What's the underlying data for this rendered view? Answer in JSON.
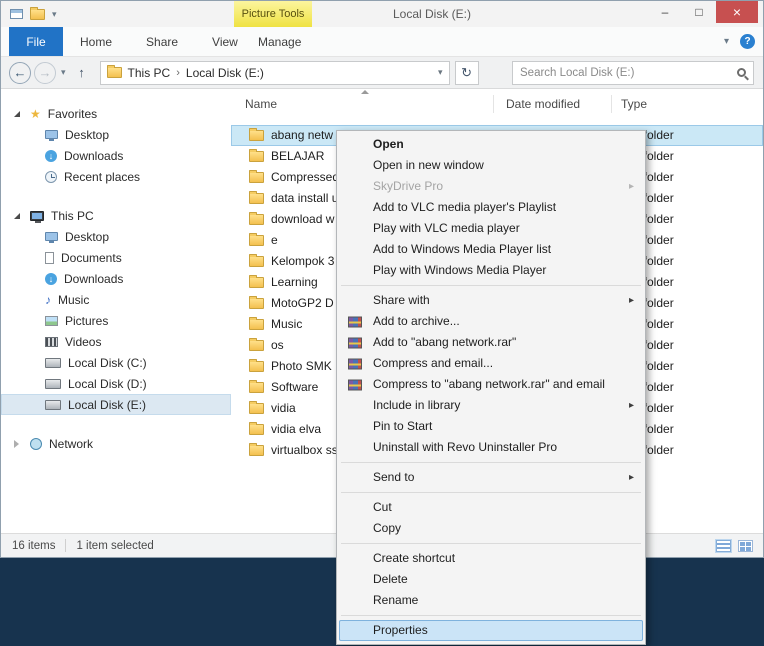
{
  "titlebar": {
    "contextual_label": "Picture Tools",
    "title": "Local Disk (E:)"
  },
  "ribbon": {
    "file_tab": "File",
    "tabs": [
      "Home",
      "Share",
      "View"
    ],
    "manage_tab": "Manage"
  },
  "address": {
    "crumbs": [
      "This PC",
      "Local Disk (E:)"
    ],
    "search_placeholder": "Search Local Disk (E:)"
  },
  "sidebar": {
    "selected": "Local Disk (E:)",
    "sections": [
      {
        "label": "Favorites",
        "icon": "star-icon",
        "expanded": true,
        "items": [
          {
            "label": "Desktop",
            "icon": "monitor-icon"
          },
          {
            "label": "Downloads",
            "icon": "download-icon"
          },
          {
            "label": "Recent places",
            "icon": "clock-icon"
          }
        ]
      },
      {
        "label": "This PC",
        "icon": "computer-icon",
        "expanded": true,
        "items": [
          {
            "label": "Desktop",
            "icon": "monitor-icon"
          },
          {
            "label": "Documents",
            "icon": "document-icon"
          },
          {
            "label": "Downloads",
            "icon": "download-icon"
          },
          {
            "label": "Music",
            "icon": "music-icon"
          },
          {
            "label": "Pictures",
            "icon": "picture-icon"
          },
          {
            "label": "Videos",
            "icon": "video-icon"
          },
          {
            "label": "Local Disk (C:)",
            "icon": "drive-icon"
          },
          {
            "label": "Local Disk (D:)",
            "icon": "drive-icon"
          },
          {
            "label": "Local Disk (E:)",
            "icon": "drive-icon"
          }
        ]
      },
      {
        "label": "Network",
        "icon": "network-icon",
        "expanded": false,
        "items": []
      }
    ]
  },
  "filelist": {
    "columns": [
      "Name",
      "Date modified",
      "Type"
    ],
    "rows": [
      {
        "name": "abang netw",
        "type": "File folder",
        "selected": true
      },
      {
        "name": "BELAJAR",
        "type": "File folder"
      },
      {
        "name": "Compressed",
        "type": "File folder"
      },
      {
        "name": "data install u",
        "type": "File folder"
      },
      {
        "name": "download w",
        "type": "File folder"
      },
      {
        "name": "e",
        "type": "File folder"
      },
      {
        "name": "Kelompok 3",
        "type": "File folder"
      },
      {
        "name": "Learning",
        "type": "File folder"
      },
      {
        "name": "MotoGP2 D",
        "type": "File folder"
      },
      {
        "name": "Music",
        "type": "File folder"
      },
      {
        "name": "os",
        "type": "File folder"
      },
      {
        "name": "Photo SMK",
        "type": "File folder"
      },
      {
        "name": "Software",
        "type": "File folder"
      },
      {
        "name": "vidia",
        "type": "File folder"
      },
      {
        "name": "vidia elva",
        "type": "File folder"
      },
      {
        "name": "virtualbox ss",
        "type": "File folder"
      }
    ]
  },
  "context_menu": {
    "items": [
      {
        "label": "Open",
        "bold": true
      },
      {
        "label": "Open in new window"
      },
      {
        "label": "SkyDrive Pro",
        "disabled": true,
        "submenu": true
      },
      {
        "label": "Add to VLC media player's Playlist"
      },
      {
        "label": "Play with VLC media player"
      },
      {
        "label": "Add to Windows Media Player list"
      },
      {
        "label": "Play with Windows Media Player"
      },
      {
        "separator": true
      },
      {
        "label": "Share with",
        "submenu": true
      },
      {
        "label": "Add to archive...",
        "icon": "winrar-icon"
      },
      {
        "label": "Add to \"abang network.rar\"",
        "icon": "winrar-icon"
      },
      {
        "label": "Compress and email...",
        "icon": "winrar-icon"
      },
      {
        "label": "Compress to \"abang network.rar\" and email",
        "icon": "winrar-icon"
      },
      {
        "label": "Include in library",
        "submenu": true
      },
      {
        "label": "Pin to Start"
      },
      {
        "label": "Uninstall with Revo Uninstaller Pro"
      },
      {
        "separator": true
      },
      {
        "label": "Send to",
        "submenu": true
      },
      {
        "separator": true
      },
      {
        "label": "Cut"
      },
      {
        "label": "Copy"
      },
      {
        "separator": true
      },
      {
        "label": "Create shortcut"
      },
      {
        "label": "Delete"
      },
      {
        "label": "Rename"
      },
      {
        "separator": true
      },
      {
        "label": "Properties",
        "highlighted": true
      }
    ]
  },
  "statusbar": {
    "items_count": "16 items",
    "selection_count": "1 item selected"
  }
}
